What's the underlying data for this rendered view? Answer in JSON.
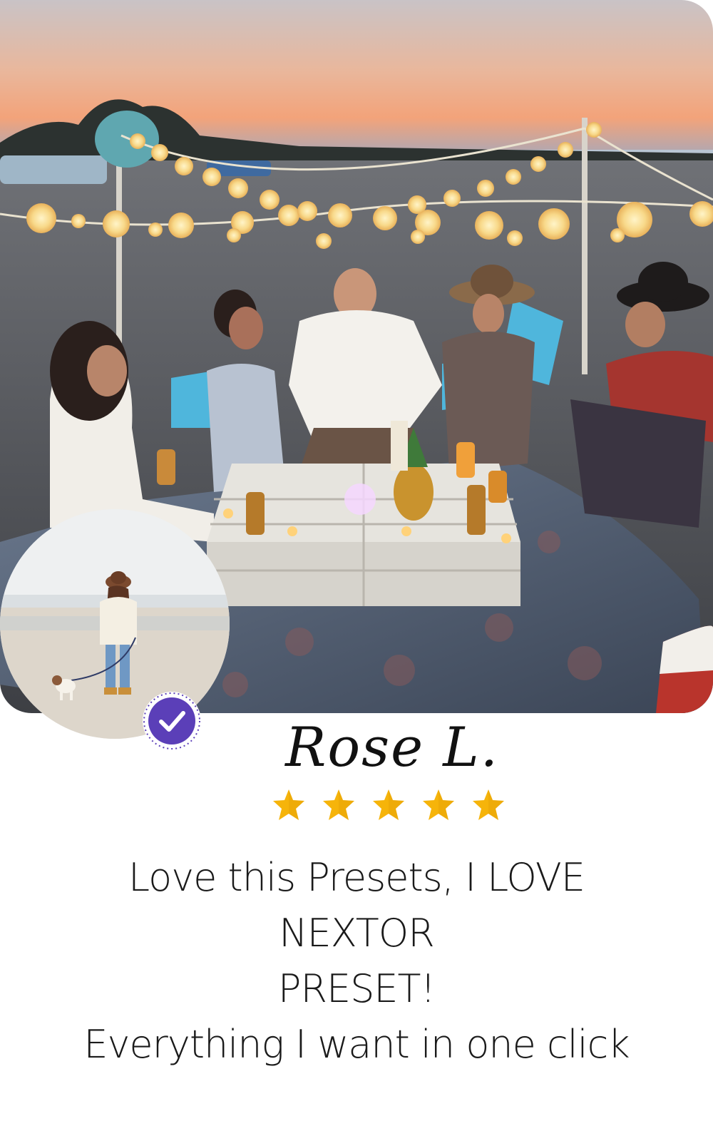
{
  "testimonial": {
    "name": "Rose L.",
    "rating": 5,
    "rating_max": 5,
    "review_line1": "Love this Presets, I LOVE NEXTOR",
    "review_line2": "PRESET!",
    "review_line3": "Everything I want in one click"
  },
  "icons": {
    "verified": "check-badge-icon",
    "star": "star-icon"
  },
  "colors": {
    "star": "#f6b40a",
    "badge": "#5b3fb8",
    "text": "#1a1a1a"
  }
}
